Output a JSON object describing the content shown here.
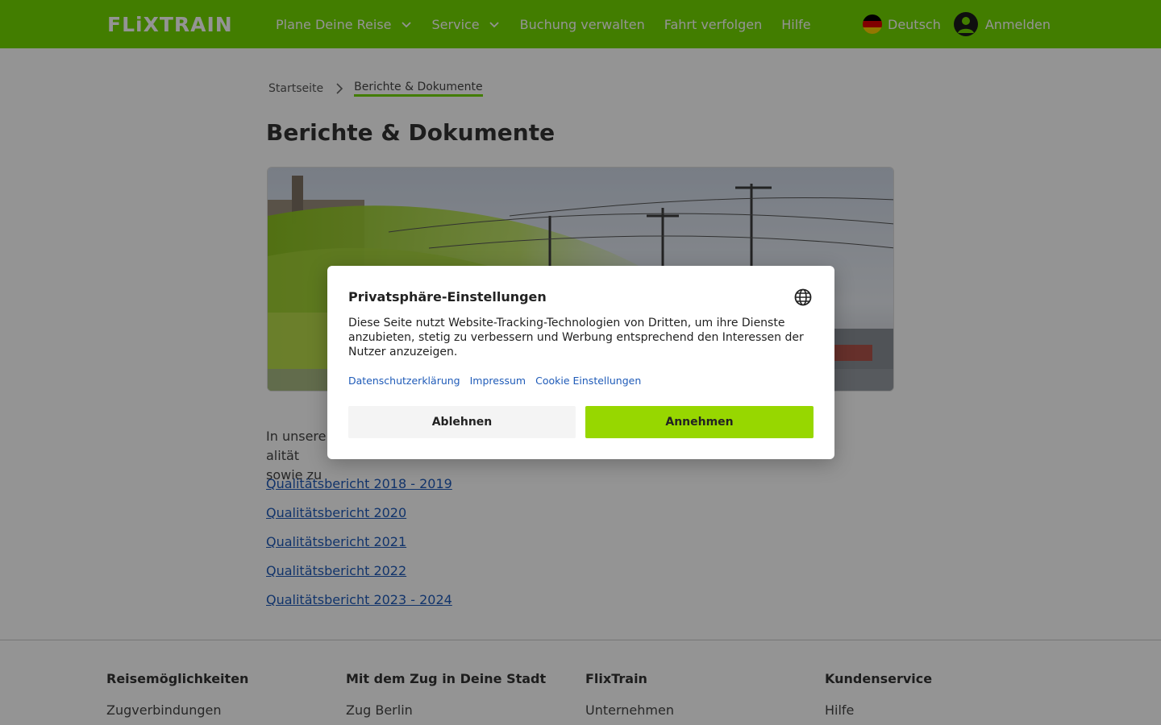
{
  "header": {
    "logo": "FLiXTRAIN",
    "nav": [
      {
        "label": "Plane Deine Reise",
        "dropdown": true
      },
      {
        "label": "Service",
        "dropdown": true
      },
      {
        "label": "Buchung verwalten",
        "dropdown": false
      },
      {
        "label": "Fahrt verfolgen",
        "dropdown": false
      },
      {
        "label": "Hilfe",
        "dropdown": false
      }
    ],
    "language": "Deutsch",
    "login": "Anmelden"
  },
  "breadcrumb": {
    "home": "Startseite",
    "current": "Berichte & Dokumente"
  },
  "main": {
    "title": "Berichte & Dokumente",
    "intro_visible_start": "In unsere",
    "intro_visible_end": "alität",
    "intro_line2_start": "sowie zu",
    "links": [
      "Qualitätsbericht 2018 - 2019",
      "Qualitätsbericht 2020",
      "Qualitätsbericht 2021",
      "Qualitätsbericht 2022",
      "Qualitätsbericht 2023 - 2024"
    ]
  },
  "footer": {
    "columns": [
      {
        "heading": "Reisemöglichkeiten",
        "first_link": "Zugverbindungen"
      },
      {
        "heading": "Mit dem Zug in Deine Stadt",
        "first_link": "Zug Berlin"
      },
      {
        "heading": "FlixTrain",
        "first_link": "Unternehmen"
      },
      {
        "heading": "Kundenservice",
        "first_link": "Hilfe"
      }
    ]
  },
  "modal": {
    "title": "Privatsphäre-Einstellungen",
    "text": "Diese Seite nutzt Website-Tracking-Technologien von Dritten, um ihre Dienste anzubieten, stetig zu verbessern und Werbung entsprechend den Interessen der Nutzer anzuzeigen.",
    "links": [
      "Datenschutzerklärung",
      "Impressum",
      "Cookie Einstellungen"
    ],
    "decline": "Ablehnen",
    "accept": "Annehmen"
  },
  "colors": {
    "brand": "#73d700",
    "accept_button": "#97d700",
    "link": "#1f5bb8"
  }
}
